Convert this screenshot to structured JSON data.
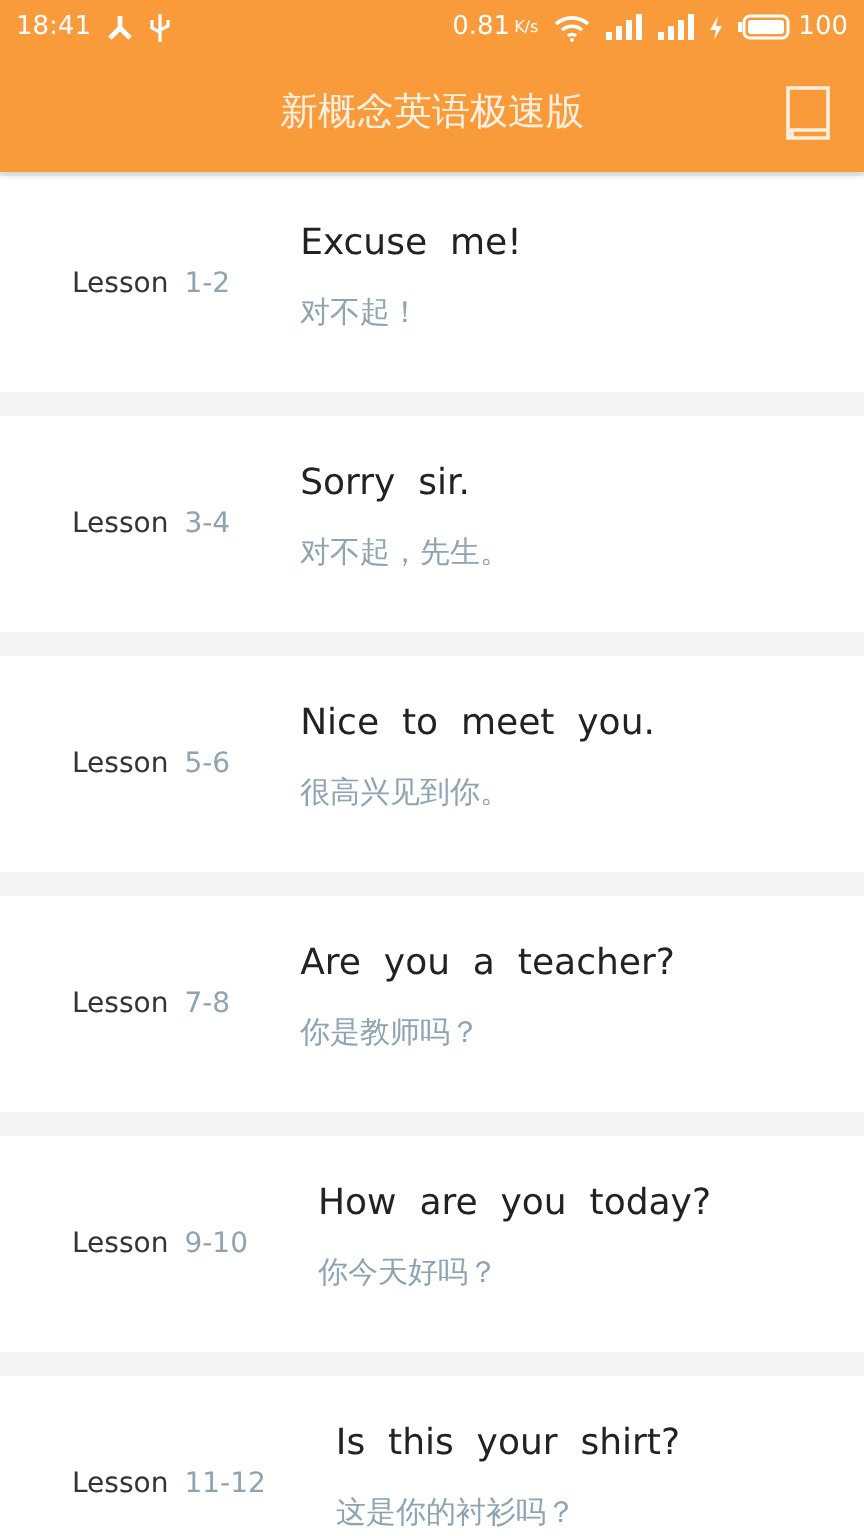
{
  "status_bar": {
    "time": "18:41",
    "speed": "0.81",
    "speed_unit": "K/s",
    "battery": "100"
  },
  "app_bar": {
    "title": "新概念英语极速版"
  },
  "lessons": [
    {
      "label": "Lesson",
      "number": "1-2",
      "title": "Excuse  me!",
      "translation": "对不起！"
    },
    {
      "label": "Lesson",
      "number": "3-4",
      "title": "Sorry  sir.",
      "translation": "对不起，先生。"
    },
    {
      "label": "Lesson",
      "number": "5-6",
      "title": "Nice  to  meet  you.",
      "translation": "很高兴见到你。"
    },
    {
      "label": "Lesson",
      "number": "7-8",
      "title": "Are  you  a  teacher?",
      "translation": "你是教师吗？"
    },
    {
      "label": "Lesson",
      "number": "9-10",
      "title": "How  are  you  today?",
      "translation": "你今天好吗？"
    },
    {
      "label": "Lesson",
      "number": "11-12",
      "title": "Is  this  your  shirt?",
      "translation": "这是你的衬衫吗？"
    }
  ]
}
